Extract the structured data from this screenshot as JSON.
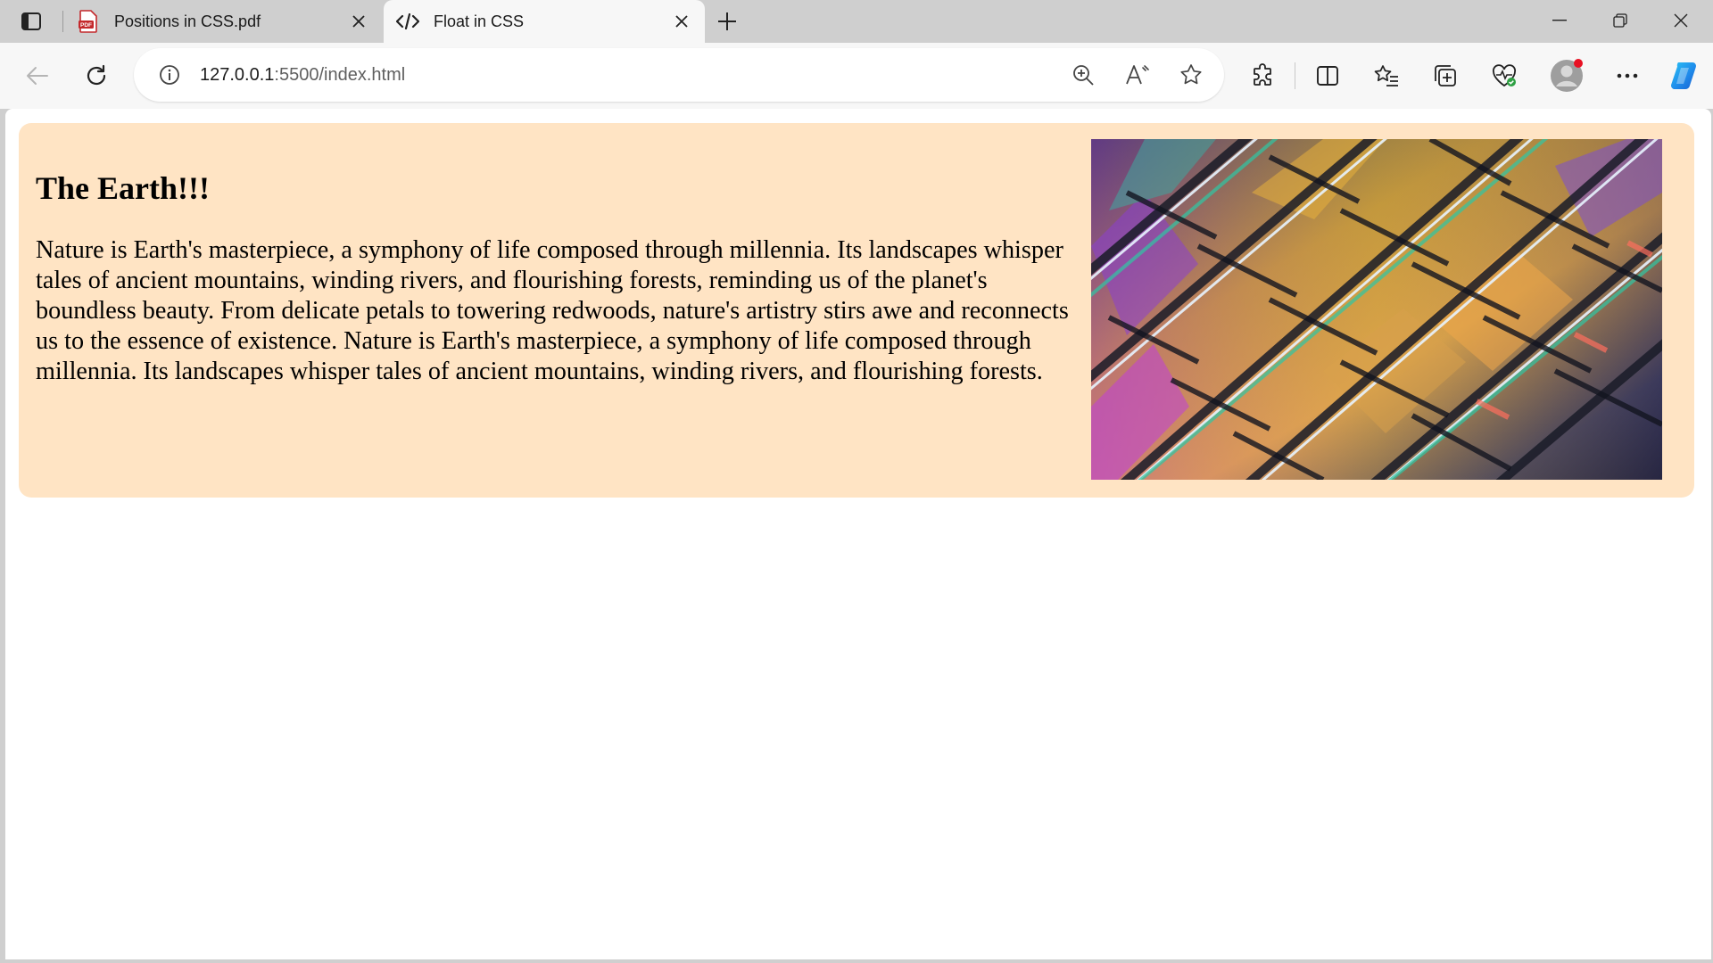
{
  "browser": {
    "tabs": [
      {
        "title": "Positions in CSS.pdf",
        "icon": "pdf-icon",
        "active": false
      },
      {
        "title": "Float in CSS",
        "icon": "code-icon",
        "active": true
      }
    ],
    "address_bar": {
      "host": "127.0.0.1",
      "path": ":5500/index.html"
    },
    "toolbar_icons": [
      "back-arrow-icon",
      "refresh-icon",
      "info-icon",
      "zoom-icon",
      "read-aloud-icon",
      "favorite-star-icon",
      "extensions-icon",
      "split-screen-icon",
      "favorites-icon",
      "collections-icon",
      "browser-essentials-icon",
      "profile-avatar",
      "more-icon",
      "copilot-icon"
    ],
    "window_controls": [
      "minimize-icon",
      "restore-icon",
      "close-icon"
    ]
  },
  "page": {
    "heading": "The Earth!!!",
    "paragraph": "Nature is Earth's masterpiece, a symphony of life composed through millennia. Its landscapes whisper tales of ancient mountains, winding rivers, and flourishing forests, reminding us of the planet's boundless beauty. From delicate petals to towering redwoods, nature's artistry stirs awe and reconnects us to the essence of existence. Nature is Earth's masterpiece, a symphony of life composed through millennia. Its landscapes whisper tales of ancient mountains, winding rivers, and flourishing forests.",
    "container_background": "#ffe4c4",
    "image": {
      "subject": "colorful glass building facade",
      "float": "right"
    }
  },
  "colors": {
    "tabstrip": "#cfcfcf",
    "toolbar": "#f7f7f7",
    "accent_badge": "#e81123",
    "copilot_blue": "#1f8ceb"
  }
}
